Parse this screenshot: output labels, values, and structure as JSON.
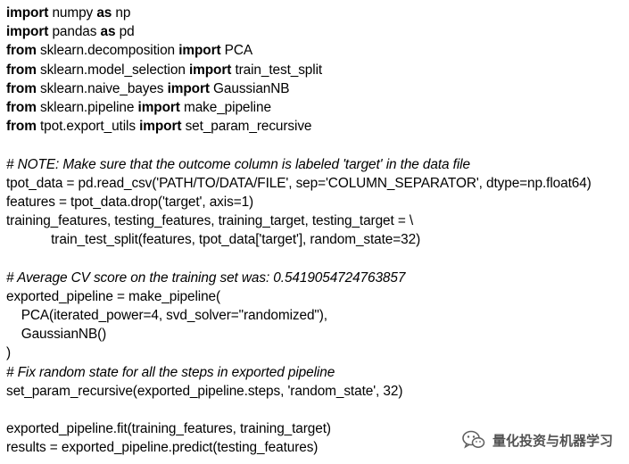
{
  "code": {
    "imports": [
      {
        "kw1": "import",
        "mod": " numpy ",
        "kw2": "as",
        "name": " np"
      },
      {
        "kw1": "import",
        "mod": " pandas ",
        "kw2": "as",
        "name": " pd"
      },
      {
        "kw1": "from",
        "mod": " sklearn.decomposition ",
        "kw2": "import",
        "name": " PCA"
      },
      {
        "kw1": "from",
        "mod": " sklearn.model_selection ",
        "kw2": "import",
        "name": " train_test_split"
      },
      {
        "kw1": "from",
        "mod": " sklearn.naive_bayes ",
        "kw2": "import",
        "name": " GaussianNB"
      },
      {
        "kw1": "from",
        "mod": " sklearn.pipeline ",
        "kw2": "import",
        "name": " make_pipeline"
      },
      {
        "kw1": "from",
        "mod": " tpot.export_utils ",
        "kw2": "import",
        "name": " set_param_recursive"
      }
    ],
    "comment_1": "# NOTE: Make sure that the outcome column is labeled 'target' in the data file",
    "line_tpot_data": "tpot_data = pd.read_csv('PATH/TO/DATA/FILE', sep='COLUMN_SEPARATOR', dtype=np.float64)",
    "line_features": "features = tpot_data.drop('target', axis=1)",
    "line_split_1": "training_features, testing_features, training_target, testing_target = \\",
    "line_split_2": "            train_test_split(features, tpot_data['target'], random_state=32)",
    "comment_2": "# Average CV score on the training set was: 0.5419054724763857",
    "line_pipeline_1": "exported_pipeline = make_pipeline(",
    "line_pipeline_2": "    PCA(iterated_power=4, svd_solver=\"randomized\"),",
    "line_pipeline_3": "    GaussianNB()",
    "line_pipeline_4": ")",
    "comment_3": "# Fix random state for all the steps in exported pipeline",
    "line_set_param": "set_param_recursive(exported_pipeline.steps, 'random_state', 32)",
    "line_fit": "exported_pipeline.fit(training_features, training_target)",
    "line_predict": "results = exported_pipeline.predict(testing_features)"
  },
  "watermark": {
    "icon": "wechat-icon",
    "text": "量化投资与机器学习"
  }
}
